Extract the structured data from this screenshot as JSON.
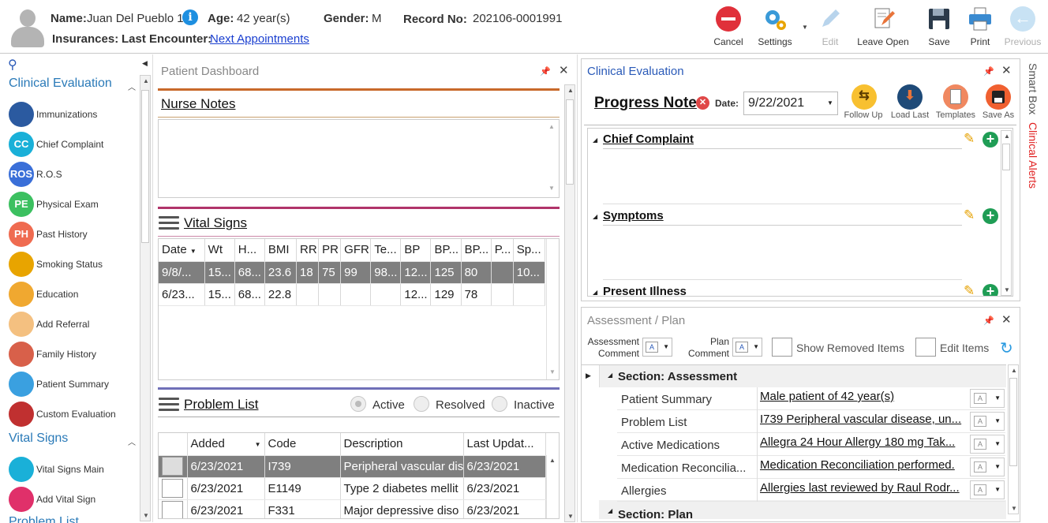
{
  "header": {
    "name_label": "Name:",
    "name_value": "Juan Del Pueblo 1",
    "age_label": "Age:",
    "age_value": "42 year(s)",
    "gender_label": "Gender:",
    "gender_value": "M",
    "record_label": "Record No:",
    "record_value": "202106-0001991",
    "insurances_label": "Insurances:",
    "last_encounter_label": "Last Encounter:",
    "next_appointments": "Next Appointments",
    "info_glyph": "i"
  },
  "toolbar": {
    "cancel": "Cancel",
    "settings": "Settings",
    "edit": "Edit",
    "leave_open": "Leave Open",
    "save": "Save",
    "print": "Print",
    "previous": "Previous"
  },
  "nav": {
    "section1": "Clinical Evaluation",
    "items1": [
      {
        "label": "Immunizations",
        "icon": "syringe-icon",
        "glyph": "",
        "color": "#2b5aa0"
      },
      {
        "label": "Chief Complaint",
        "icon": "cc-icon",
        "glyph": "CC",
        "color": "#1ab0d8"
      },
      {
        "label": "R.O.S",
        "icon": "ros-icon",
        "glyph": "ROS",
        "color": "#3a6fd8"
      },
      {
        "label": "Physical Exam",
        "icon": "pe-icon",
        "glyph": "PE",
        "color": "#3cc060"
      },
      {
        "label": "Past History",
        "icon": "ph-icon",
        "glyph": "PH",
        "color": "#ef6b50"
      },
      {
        "label": "Smoking Status",
        "icon": "no-smoking-icon",
        "glyph": "",
        "color": "#e8a400"
      },
      {
        "label": "Education",
        "icon": "education-icon",
        "glyph": "",
        "color": "#f0a830"
      },
      {
        "label": "Add Referral",
        "icon": "referral-icon",
        "glyph": "",
        "color": "#f4c080"
      },
      {
        "label": "Family History",
        "icon": "family-icon",
        "glyph": "",
        "color": "#d8604a"
      },
      {
        "label": "Patient Summary",
        "icon": "patient-summary-icon",
        "glyph": "",
        "color": "#3aa0e0"
      },
      {
        "label": "Custom Evaluation",
        "icon": "stethoscope-icon",
        "glyph": "",
        "color": "#c03030"
      }
    ],
    "section2": "Vital Signs",
    "items2": [
      {
        "label": "Vital Signs Main",
        "icon": "heartbeat-icon",
        "glyph": "",
        "color": "#1ab0d8"
      },
      {
        "label": "Add Vital Sign",
        "icon": "heart-plus-icon",
        "glyph": "",
        "color": "#e0306a"
      }
    ],
    "section3": "Problem List"
  },
  "dashboard": {
    "title": "Patient Dashboard",
    "nurse_notes": "Nurse Notes",
    "vital_signs": "Vital Signs",
    "vital_columns": [
      "Date",
      "Wt",
      "H...",
      "BMI",
      "RR",
      "PR",
      "GFR",
      "Te...",
      "BP",
      "BP...",
      "BP...",
      "P...",
      "Sp..."
    ],
    "vital_rows": [
      [
        "9/8/...",
        "15...",
        "68...",
        "23.6",
        "18",
        "75",
        "99",
        "98...",
        "12...",
        "125",
        "80",
        "",
        "10..."
      ],
      [
        "6/23...",
        "15...",
        "68...",
        "22.8",
        "",
        "",
        "",
        "",
        "12...",
        "129",
        "78",
        "",
        ""
      ]
    ],
    "problem_list": "Problem List",
    "radio_active": "Active",
    "radio_resolved": "Resolved",
    "radio_inactive": "Inactive",
    "problem_columns": [
      "",
      "Added",
      "Code",
      "Description",
      "Last Updat..."
    ],
    "problem_rows": [
      [
        "",
        "6/23/2021",
        "I739",
        "Peripheral vascular dis",
        "6/23/2021"
      ],
      [
        "",
        "6/23/2021",
        "E1149",
        "Type 2 diabetes mellit",
        "6/23/2021"
      ],
      [
        "",
        "6/23/2021",
        "F331",
        "Major depressive diso",
        "6/23/2021"
      ]
    ]
  },
  "clinical": {
    "title": "Clinical Evaluation",
    "progress_note": "Progress Note",
    "date_label": "Date:",
    "date_value": "9/22/2021",
    "follow_up": "Follow Up",
    "load_last": "Load Last",
    "templates": "Templates",
    "save_as": "Save As",
    "sections": [
      "Chief Complaint",
      "Symptoms",
      "Present Illness"
    ]
  },
  "assessment": {
    "title": "Assessment / Plan",
    "assessment_comment": "Assessment Comment",
    "plan_comment": "Plan Comment",
    "show_removed": "Show Removed Items",
    "edit_items": "Edit Items",
    "section_assessment": "Section: Assessment",
    "section_plan": "Section: Plan",
    "rows": [
      {
        "k": "Patient Summary",
        "v": "Male patient of 42 year(s)"
      },
      {
        "k": "Problem List",
        "v": "I739 Peripheral vascular disease, un..."
      },
      {
        "k": "Active Medications",
        "v": "Allegra 24 Hour Allergy 180 mg Tak..."
      },
      {
        "k": "Medication Reconcilia...",
        "v": "Medication Reconciliation performed."
      },
      {
        "k": "Allergies",
        "v": "Allergies last reviewed by Raul Rodr..."
      }
    ]
  },
  "side_tabs": {
    "smart_box": "Smart Box",
    "clinical_alerts": "Clinical Alerts"
  },
  "colors": {
    "nurse_line": "#c8692a",
    "vital_line": "#b0346a",
    "problem_line": "#7070b8",
    "selected_row": "#7f7f7f",
    "accent_blue": "#2a7ab8",
    "alert_red": "#e02020"
  }
}
